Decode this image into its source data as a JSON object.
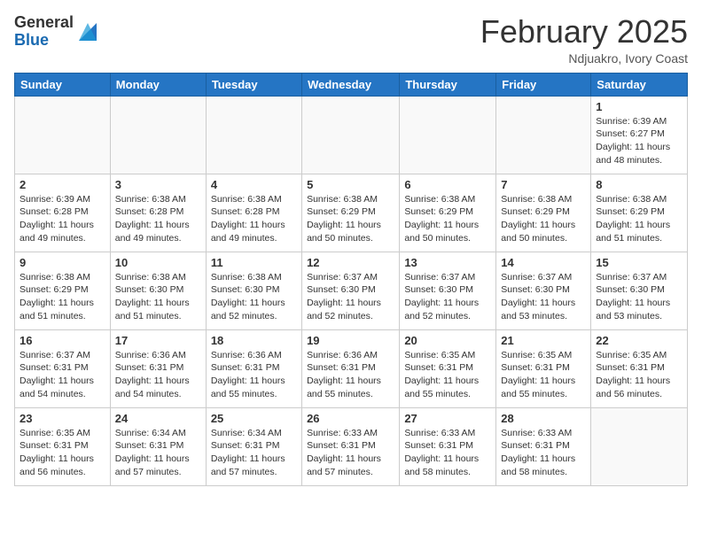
{
  "logo": {
    "general": "General",
    "blue": "Blue"
  },
  "header": {
    "month": "February 2025",
    "location": "Ndjuakro, Ivory Coast"
  },
  "days_of_week": [
    "Sunday",
    "Monday",
    "Tuesday",
    "Wednesday",
    "Thursday",
    "Friday",
    "Saturday"
  ],
  "weeks": [
    [
      {
        "day": "",
        "info": ""
      },
      {
        "day": "",
        "info": ""
      },
      {
        "day": "",
        "info": ""
      },
      {
        "day": "",
        "info": ""
      },
      {
        "day": "",
        "info": ""
      },
      {
        "day": "",
        "info": ""
      },
      {
        "day": "1",
        "info": "Sunrise: 6:39 AM\nSunset: 6:27 PM\nDaylight: 11 hours\nand 48 minutes."
      }
    ],
    [
      {
        "day": "2",
        "info": "Sunrise: 6:39 AM\nSunset: 6:28 PM\nDaylight: 11 hours\nand 49 minutes."
      },
      {
        "day": "3",
        "info": "Sunrise: 6:38 AM\nSunset: 6:28 PM\nDaylight: 11 hours\nand 49 minutes."
      },
      {
        "day": "4",
        "info": "Sunrise: 6:38 AM\nSunset: 6:28 PM\nDaylight: 11 hours\nand 49 minutes."
      },
      {
        "day": "5",
        "info": "Sunrise: 6:38 AM\nSunset: 6:29 PM\nDaylight: 11 hours\nand 50 minutes."
      },
      {
        "day": "6",
        "info": "Sunrise: 6:38 AM\nSunset: 6:29 PM\nDaylight: 11 hours\nand 50 minutes."
      },
      {
        "day": "7",
        "info": "Sunrise: 6:38 AM\nSunset: 6:29 PM\nDaylight: 11 hours\nand 50 minutes."
      },
      {
        "day": "8",
        "info": "Sunrise: 6:38 AM\nSunset: 6:29 PM\nDaylight: 11 hours\nand 51 minutes."
      }
    ],
    [
      {
        "day": "9",
        "info": "Sunrise: 6:38 AM\nSunset: 6:29 PM\nDaylight: 11 hours\nand 51 minutes."
      },
      {
        "day": "10",
        "info": "Sunrise: 6:38 AM\nSunset: 6:30 PM\nDaylight: 11 hours\nand 51 minutes."
      },
      {
        "day": "11",
        "info": "Sunrise: 6:38 AM\nSunset: 6:30 PM\nDaylight: 11 hours\nand 52 minutes."
      },
      {
        "day": "12",
        "info": "Sunrise: 6:37 AM\nSunset: 6:30 PM\nDaylight: 11 hours\nand 52 minutes."
      },
      {
        "day": "13",
        "info": "Sunrise: 6:37 AM\nSunset: 6:30 PM\nDaylight: 11 hours\nand 52 minutes."
      },
      {
        "day": "14",
        "info": "Sunrise: 6:37 AM\nSunset: 6:30 PM\nDaylight: 11 hours\nand 53 minutes."
      },
      {
        "day": "15",
        "info": "Sunrise: 6:37 AM\nSunset: 6:30 PM\nDaylight: 11 hours\nand 53 minutes."
      }
    ],
    [
      {
        "day": "16",
        "info": "Sunrise: 6:37 AM\nSunset: 6:31 PM\nDaylight: 11 hours\nand 54 minutes."
      },
      {
        "day": "17",
        "info": "Sunrise: 6:36 AM\nSunset: 6:31 PM\nDaylight: 11 hours\nand 54 minutes."
      },
      {
        "day": "18",
        "info": "Sunrise: 6:36 AM\nSunset: 6:31 PM\nDaylight: 11 hours\nand 55 minutes."
      },
      {
        "day": "19",
        "info": "Sunrise: 6:36 AM\nSunset: 6:31 PM\nDaylight: 11 hours\nand 55 minutes."
      },
      {
        "day": "20",
        "info": "Sunrise: 6:35 AM\nSunset: 6:31 PM\nDaylight: 11 hours\nand 55 minutes."
      },
      {
        "day": "21",
        "info": "Sunrise: 6:35 AM\nSunset: 6:31 PM\nDaylight: 11 hours\nand 55 minutes."
      },
      {
        "day": "22",
        "info": "Sunrise: 6:35 AM\nSunset: 6:31 PM\nDaylight: 11 hours\nand 56 minutes."
      }
    ],
    [
      {
        "day": "23",
        "info": "Sunrise: 6:35 AM\nSunset: 6:31 PM\nDaylight: 11 hours\nand 56 minutes."
      },
      {
        "day": "24",
        "info": "Sunrise: 6:34 AM\nSunset: 6:31 PM\nDaylight: 11 hours\nand 57 minutes."
      },
      {
        "day": "25",
        "info": "Sunrise: 6:34 AM\nSunset: 6:31 PM\nDaylight: 11 hours\nand 57 minutes."
      },
      {
        "day": "26",
        "info": "Sunrise: 6:33 AM\nSunset: 6:31 PM\nDaylight: 11 hours\nand 57 minutes."
      },
      {
        "day": "27",
        "info": "Sunrise: 6:33 AM\nSunset: 6:31 PM\nDaylight: 11 hours\nand 58 minutes."
      },
      {
        "day": "28",
        "info": "Sunrise: 6:33 AM\nSunset: 6:31 PM\nDaylight: 11 hours\nand 58 minutes."
      },
      {
        "day": "",
        "info": ""
      }
    ]
  ]
}
